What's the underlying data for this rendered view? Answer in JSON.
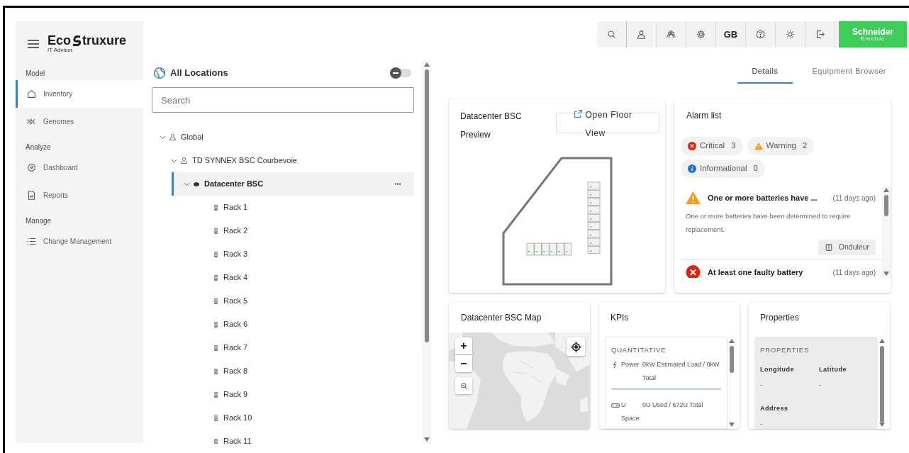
{
  "logo": {
    "part1": "Eco",
    "part2": "truxure",
    "subtitle": "IT Advisor"
  },
  "sidebar": {
    "sections": [
      {
        "title": "Model",
        "items": [
          {
            "label": "Inventory",
            "selected": true
          },
          {
            "label": "Genomes",
            "selected": false
          }
        ]
      },
      {
        "title": "Analyze",
        "items": [
          {
            "label": "Dashboard",
            "selected": false
          },
          {
            "label": "Reports",
            "selected": false
          }
        ]
      },
      {
        "title": "Manage",
        "items": [
          {
            "label": "Change Management",
            "selected": false
          }
        ]
      }
    ]
  },
  "locations": {
    "title": "All Locations",
    "toggle_on": false,
    "search": {
      "placeholder": "Search"
    },
    "tree": [
      {
        "label": "Global",
        "expanded": true,
        "selected": false,
        "children": [
          {
            "label": "TD SYNNEX BSC Courbevoie",
            "expanded": true,
            "selected": false,
            "children": [
              {
                "label": "Datacenter BSC",
                "expanded": true,
                "selected": true,
                "children": [
                  {
                    "label": "Rack 1",
                    "selected": false
                  },
                  {
                    "label": "Rack 2",
                    "selected": false
                  },
                  {
                    "label": "Rack 3",
                    "selected": false
                  },
                  {
                    "label": "Rack 4",
                    "selected": false
                  },
                  {
                    "label": "Rack 5",
                    "selected": false
                  },
                  {
                    "label": "Rack 6",
                    "selected": false
                  },
                  {
                    "label": "Rack 7",
                    "selected": false
                  },
                  {
                    "label": "Rack 8",
                    "selected": false
                  },
                  {
                    "label": "Rack 9",
                    "selected": false
                  },
                  {
                    "label": "Rack 10",
                    "selected": false
                  },
                  {
                    "label": "Rack 11",
                    "selected": false
                  }
                ]
              }
            ]
          }
        ]
      }
    ]
  },
  "toolbar": {
    "language": "GB",
    "brand": {
      "line1": "Schneider",
      "line2": "Electric"
    }
  },
  "tabs": [
    {
      "label": "Details",
      "selected": true
    },
    {
      "label": "Equipment Browser",
      "selected": false
    }
  ],
  "floor_preview": {
    "title": "Datacenter BSC Preview",
    "button": "Open Floor View"
  },
  "alarm_list": {
    "title": "Alarm list",
    "counts": [
      {
        "kind": "critical",
        "label": "Critical",
        "count": "3",
        "color": "#e0210f"
      },
      {
        "kind": "warning",
        "label": "Warning",
        "count": "2",
        "color": "#f39c1f"
      },
      {
        "kind": "info",
        "label": "Informational",
        "count": "0",
        "color": "#1f6fe0"
      }
    ],
    "alarms": [
      {
        "kind": "warning",
        "title": "One or more batteries have ...",
        "time": "(11 days ago)",
        "description": "One or more batteries have been determined to require replacement.",
        "source": "Onduleur"
      },
      {
        "kind": "critical",
        "title": "At least one faulty battery",
        "time": "(11 days ago)"
      }
    ]
  },
  "map_card": {
    "title": "Datacenter BSC Map",
    "zoom_in": "+",
    "zoom_out": "−"
  },
  "kpis": {
    "title": "KPIs",
    "section": "QUANTITATIVE",
    "rows": [
      {
        "kind": "power",
        "label": "Power",
        "value": "0kW Estimated Load / 0kW Total"
      },
      {
        "kind": "space",
        "label": "U Space",
        "value": "0U Used / 672U Total"
      }
    ]
  },
  "properties": {
    "title": "Properties",
    "section": "PROPERTIES",
    "fields": [
      {
        "label": "Longitude",
        "value": "-"
      },
      {
        "label": "Latitude",
        "value": "-"
      },
      {
        "label": "Address",
        "value": "-"
      }
    ]
  }
}
